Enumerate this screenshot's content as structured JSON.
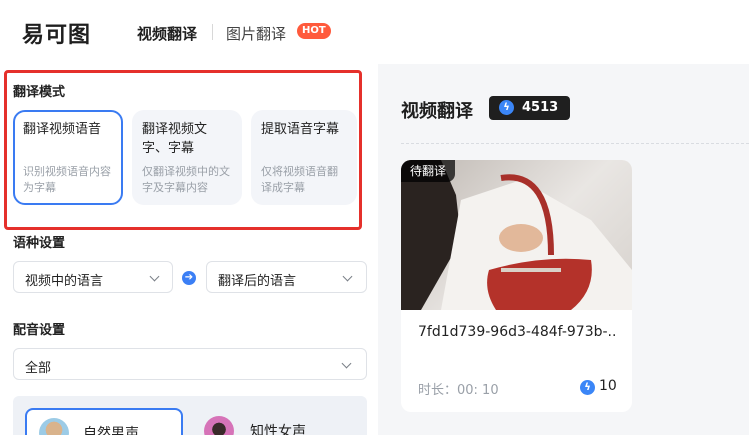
{
  "header": {
    "logo": "易可图",
    "nav": {
      "video": "视频翻译",
      "image": "图片翻译",
      "hot": "HOT"
    }
  },
  "translate_mode": {
    "title": "翻译模式",
    "cards": [
      {
        "name": "翻译视频语音",
        "desc": "识别视频语音内容为字幕",
        "selected": true
      },
      {
        "name": "翻译视频文字、字幕",
        "desc": "仅翻译视频中的文字及字幕内容",
        "selected": false
      },
      {
        "name": "提取语音字幕",
        "desc": "仅将视频语音翻译成字幕",
        "selected": false
      }
    ]
  },
  "language": {
    "title": "语种设置",
    "source_placeholder": "视频中的语言",
    "target_placeholder": "翻译后的语言"
  },
  "dubbing": {
    "title": "配音设置",
    "filter_value": "全部",
    "voices": [
      {
        "name": "自然男声",
        "selected": true
      },
      {
        "name": "知性女声",
        "selected": false
      }
    ]
  },
  "main": {
    "title": "视频翻译",
    "credits": "4513",
    "video": {
      "status": "待翻译",
      "name": "7fd1d739-96d3-484f-973b-...",
      "duration": "时长：00: 10",
      "cost": "10"
    }
  },
  "colors": {
    "accent": "#3a7bf2",
    "highlight_outline": "#e5302b",
    "hot_badge": "#ff5a3c"
  }
}
